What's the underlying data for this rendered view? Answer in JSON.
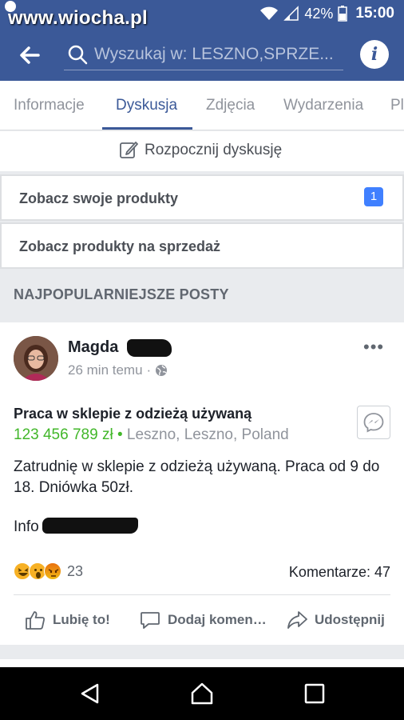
{
  "status_bar": {
    "watermark": "www.wiocha.pl",
    "battery": "42%",
    "time": "15:00"
  },
  "search": {
    "placeholder": "Wyszukaj w: LESZNO,SPRZE..."
  },
  "tabs": [
    {
      "label": "Informacje",
      "active": false
    },
    {
      "label": "Dyskusja",
      "active": true
    },
    {
      "label": "Zdjęcia",
      "active": false
    },
    {
      "label": "Wydarzenia",
      "active": false
    },
    {
      "label": "Pl",
      "active": false
    }
  ],
  "start_discussion": {
    "label": "Rozpocznij dyskusję"
  },
  "products": {
    "own_label": "Zobacz swoje produkty",
    "own_badge": "1",
    "sale_label": "Zobacz produkty na sprzedaż"
  },
  "section": {
    "title": "NAJPOPULARNIEJSZE POSTY"
  },
  "post": {
    "author": "Magda",
    "time": "26 min temu",
    "product_title": "Praca w sklepie z odzieżą używaną",
    "price": "123 456 789 zł",
    "separator": "•",
    "location": "Leszno, Leszno, Poland",
    "body": "Zatrudnię w sklepie z odzieżą używaną. Praca od 9 do 18. Dniówka 50zł.",
    "info_prefix": "Info",
    "reaction_count": "23",
    "comments": "Komentarze: 47",
    "actions": {
      "like": "Lubię to!",
      "comment": "Dodaj komen…",
      "share": "Udostępnij"
    }
  },
  "colors": {
    "brand": "#3b5998",
    "price": "#42b72a",
    "badge": "#4080ff"
  }
}
